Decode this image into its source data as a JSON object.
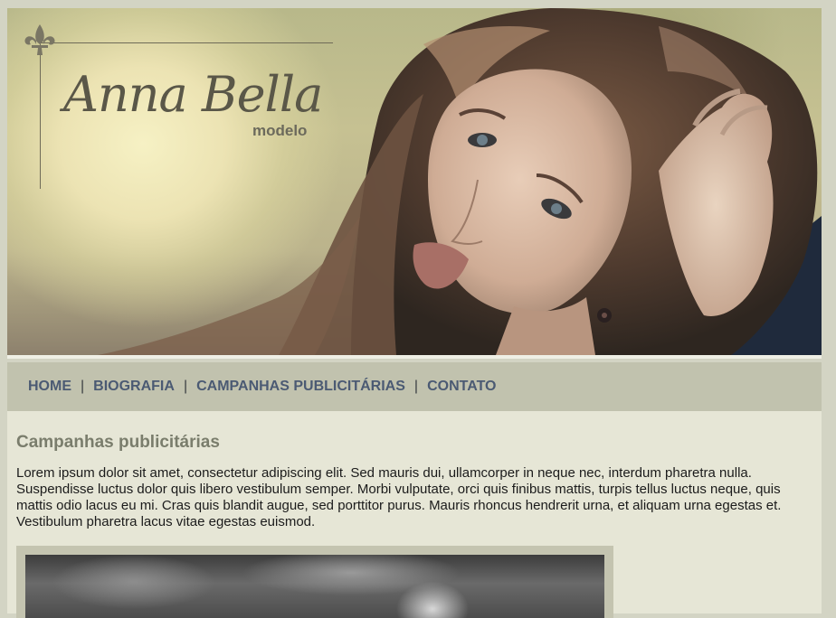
{
  "brand": {
    "name": "Anna Bella",
    "subtitle": "modelo"
  },
  "nav": {
    "items": [
      {
        "label": "HOME"
      },
      {
        "label": "BIOGRAFIA"
      },
      {
        "label": "CAMPANHAS PUBLICITÁRIAS"
      },
      {
        "label": "CONTATO"
      }
    ],
    "separator": "|"
  },
  "main": {
    "title": "Campanhas publicitárias",
    "paragraph": "Lorem ipsum dolor sit amet, consectetur adipiscing elit. Sed mauris dui, ullamcorper in neque nec, interdum pharetra nulla. Suspendisse luctus dolor quis libero vestibulum semper. Morbi vulputate, orci quis finibus mattis, turpis tellus luctus neque, quis mattis odio lacus eu mi. Cras quis blandit augue, sed porttitor purus. Mauris rhoncus hendrerit urna, et aliquam urna egestas et. Vestibulum pharetra lacus vitae egestas euismod."
  },
  "icons": {
    "logo_ornament": "fleur-de-lis-icon"
  },
  "colors": {
    "page_background": "#d3d4c4",
    "nav_background": "#c1c2ae",
    "nav_link": "#4b5a73",
    "content_background": "#e6e6d6",
    "heading": "#7a7d6c"
  }
}
